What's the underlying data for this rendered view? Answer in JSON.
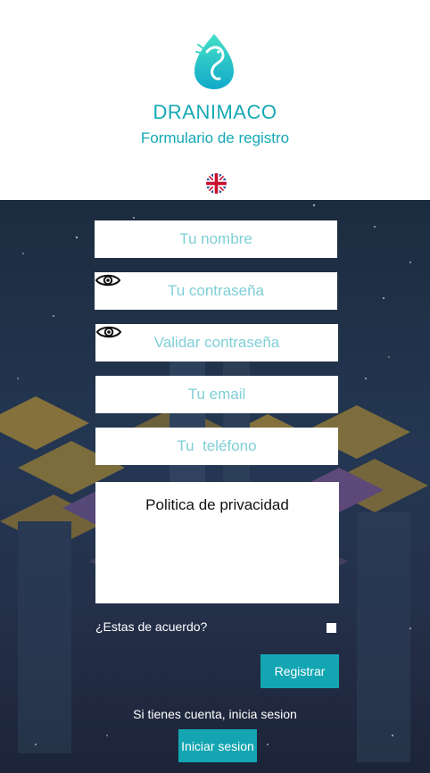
{
  "header": {
    "brand_name": "DRANIMACO",
    "subtitle": "Formulario de registro",
    "logo_icon": "dragon-drop-logo",
    "language_flag": "uk-flag-icon",
    "brand_color": "#14a9b5"
  },
  "form": {
    "name_placeholder": "Tu nombre",
    "password_placeholder": "Tu contraseña",
    "confirm_password_placeholder": "Validar contraseña",
    "email_placeholder": "Tu email",
    "phone_placeholder": "Tu  teléfono",
    "privacy_title": "Politica de privacidad",
    "agree_label": "¿Estas de acuerdo?",
    "register_button": "Registrar",
    "password_toggle_icon": "eye-icon"
  },
  "footer": {
    "account_text": "Si  tienes cuenta, inicia sesion",
    "login_button": "Iniciar sesion"
  },
  "colors": {
    "accent": "#13a5b2",
    "background_dark": "#1f2f45"
  }
}
